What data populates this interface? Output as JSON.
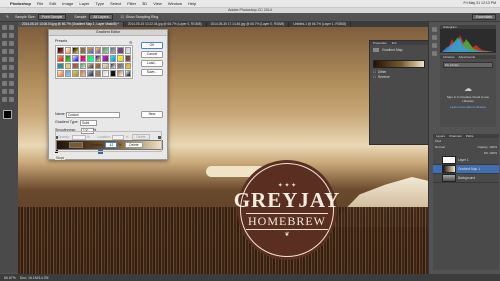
{
  "menubar": {
    "apple": "",
    "items": [
      "Photoshop",
      "File",
      "Edit",
      "Image",
      "Layer",
      "Type",
      "Select",
      "Filter",
      "3D",
      "View",
      "Window",
      "Help"
    ],
    "clock": "Fri May 31 12:13 PM",
    "user": "Photoshop"
  },
  "app_title": "Adobe Photoshop CC 2014",
  "options": {
    "sample_size_label": "Sample Size:",
    "sample_size_value": "Point Sample",
    "sample_label": "Sample:",
    "sample_value": "All Layers",
    "show_ring": "Show Sampling Ring",
    "workspace": "Essentials"
  },
  "tabs": [
    "2014-05-19 13.06.04.jpg @ 66.7% (Gradient Map 1, Layer Mask/8) *",
    "2014-05-15 10.22.34.jpg @ 66.7% (Layer 0, RGB/8)",
    "2014-05-30 17.14.46.jpg @ 66.7% (Layer 0, RGB/8)",
    "Untitled-1 @ 66.7% (Layer 1, RGB/8)"
  ],
  "logo": {
    "top": "✦ ✦ ✦",
    "name": "GREYJAY",
    "sub": "HOMEBREW",
    "ornament": "❦"
  },
  "status": {
    "zoom": "66.67%",
    "doc": "Doc: 16.1M/14.7M"
  },
  "dialog": {
    "title": "Gradient Editor",
    "presets_label": "Presets",
    "buttons": [
      "OK",
      "Cancel",
      "Load...",
      "Save..."
    ],
    "name_label": "Name:",
    "name_value": "Custom",
    "new_label": "New",
    "gradient_type_label": "Gradient Type:",
    "gradient_type_value": "Solid",
    "smoothness_label": "Smoothness:",
    "smoothness_value": "100",
    "smoothness_unit": "%",
    "stops_label": "Stops",
    "opacity_label": "Opacity:",
    "opacity_unit": "%",
    "location_label": "Location:",
    "location_value": "%",
    "delete_label": "Delete",
    "color_label": "Color:",
    "color_location_label": "Location:",
    "color_location_value": "42",
    "color_unit": "%",
    "color_delete_label": "Delete",
    "color_value": "#7a5b2e"
  },
  "swatches": [
    "#000000",
    "#ffffff",
    "#000000",
    "#e63b2e",
    "#f28c28",
    "#f2d93a",
    "#2fa84f",
    "#3a74d9",
    "#7b3ac9",
    "#c8c8c8",
    "#d9b067",
    "#6f4e2f",
    "#e8e8e8",
    "#ff0000",
    "#00ff00",
    "#0000ff",
    "#ff00ff",
    "#00ffff",
    "#ffff00",
    "#444444",
    "#1d7fd6",
    "#e0c068",
    "#b44b4b",
    "#4b9b4b",
    "#eacc9a",
    "#8a7a60",
    "#e7e7e7",
    "#303030",
    "#a05a2c",
    "#c2a070",
    "#f0f0f0",
    "#60a0d0",
    "#ffd000",
    "#ff6a00",
    "#a0c8f0",
    "#888888",
    "#d0d0d0",
    "#202020",
    "#b07a3a",
    "#ffffff"
  ],
  "properties": {
    "tabs": [
      "Properties",
      "Info"
    ],
    "title": "Gradient Map",
    "dither": "Dither",
    "reverse": "Reverse"
  },
  "libraries": {
    "tabs": [
      "Libraries",
      "Adjustments"
    ],
    "select": "My Library",
    "message": "Sign in to Creative Cloud to use Libraries",
    "link": "Learn more about Libraries"
  },
  "layers": {
    "tabs": [
      "Layers",
      "Channels",
      "Paths"
    ],
    "kind": "Kind",
    "mode": "Normal",
    "opacity": "Opacity: 100%",
    "fill": "Fill: 100%",
    "items": [
      "Layer 1",
      "Gradient Map 1",
      "Background"
    ]
  },
  "colors": {
    "accent": "#1a6fd6",
    "fg": "#000000",
    "bg": "#ffffff"
  }
}
